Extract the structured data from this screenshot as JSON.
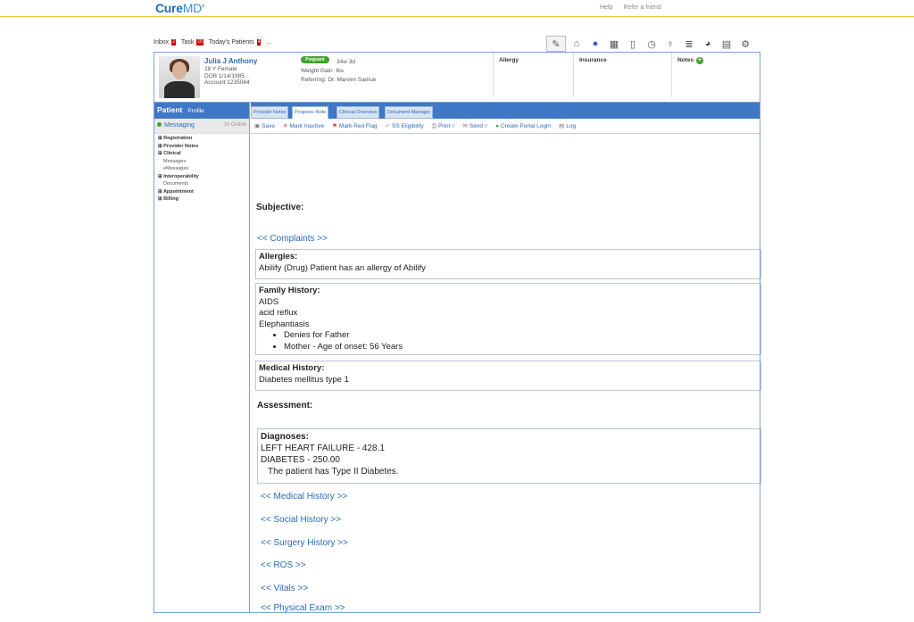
{
  "app": {
    "logo_main": "Cure",
    "logo_accent": "MD",
    "logo_tm": "®"
  },
  "top_links": {
    "help": "Help",
    "refer": "Refer a friend"
  },
  "notifications": {
    "inbox_label": "Inbox",
    "inbox_count": "2",
    "task_label": "Task",
    "task_count": "10",
    "patients_label": "Today's Patients",
    "patients_count": "4",
    "more": "..."
  },
  "toolbar_icons": [
    "stethoscope-icon",
    "home-icon",
    "user-icon",
    "calendar-icon",
    "document-icon",
    "alarm-icon",
    "money-bag-icon",
    "stack-icon",
    "pie-chart-icon",
    "film-icon",
    "gear-icon"
  ],
  "patient": {
    "name": "Julia J Anthony",
    "age_sex": "28 Y Female",
    "dob": "DOB 1/14/1985",
    "account": "Account 1235084",
    "status_badge": "Pregnant",
    "gestation": "34w 3d",
    "weight_gain_label": "Weight Gain",
    "weight_gain_unit": "lbs",
    "referring": "Referring: Dr. Marven Samue",
    "allergy_label": "Allergy",
    "insurance_label": "Insurance",
    "notes_label": "Notes"
  },
  "sidebar": {
    "title": "Patient",
    "subtitle": "Profile",
    "messaging_label": "Messaging",
    "online_label": "10 Online",
    "tree": [
      {
        "label": "Registration",
        "bold": true,
        "prefix": "⊞"
      },
      {
        "label": "Provider Notes",
        "bold": true,
        "prefix": "⊞"
      },
      {
        "label": "Clinical",
        "bold": true,
        "prefix": "⊞"
      },
      {
        "label": "Messages",
        "bold": false,
        "prefix": ""
      },
      {
        "label": "eMessages",
        "bold": false,
        "prefix": ""
      },
      {
        "label": "Interoperability",
        "bold": true,
        "prefix": "⊞"
      },
      {
        "label": "Documents",
        "bold": false,
        "prefix": ""
      },
      {
        "label": "Appointment",
        "bold": true,
        "prefix": "⊞"
      },
      {
        "label": "Billing",
        "bold": true,
        "prefix": "⊞"
      }
    ]
  },
  "tabs": {
    "t1": "Provider Notes",
    "t2": "Progress Note",
    "t3": "Clinical Overview",
    "t4": "Document Manager"
  },
  "actions": {
    "save": "Save",
    "mark_inactive": "Mark Inactive",
    "red_flag": "Mark Red Flag",
    "ss_eligibility": "SS Eligibility",
    "print": "Print ▿",
    "send": "Send ▿",
    "portal": "Create Portal Login",
    "log": "Log"
  },
  "note": {
    "subjective": "Subjective:",
    "complaints": "<< Complaints >>",
    "allergies_title": "Allergies:",
    "allergies_text": "Abilify (Drug) Patient has an allergy of Abilify",
    "family_title": "Family History:",
    "family_items": [
      "AIDS",
      "acid reflux",
      "Elephantiasis"
    ],
    "family_bullets": [
      "Denies for Father",
      "Mother - Age of onset: 56 Years"
    ],
    "medical_title": "Medical History:",
    "medical_text": "Diabetes mellitus type 1",
    "assessment": "Assessment:",
    "diagnoses_title": "Diagnoses:",
    "diag1": "LEFT HEART FAILURE - 428.1",
    "diag2": "DIABETES - 250.00",
    "diag_note": "The patient has Type II Diabetes.",
    "links": [
      "<< Medical History >>",
      "<< Social History >>",
      "<< Surgery History >>",
      "<< ROS >>",
      "<< Vitals >>",
      "<< Physical Exam >>"
    ]
  }
}
